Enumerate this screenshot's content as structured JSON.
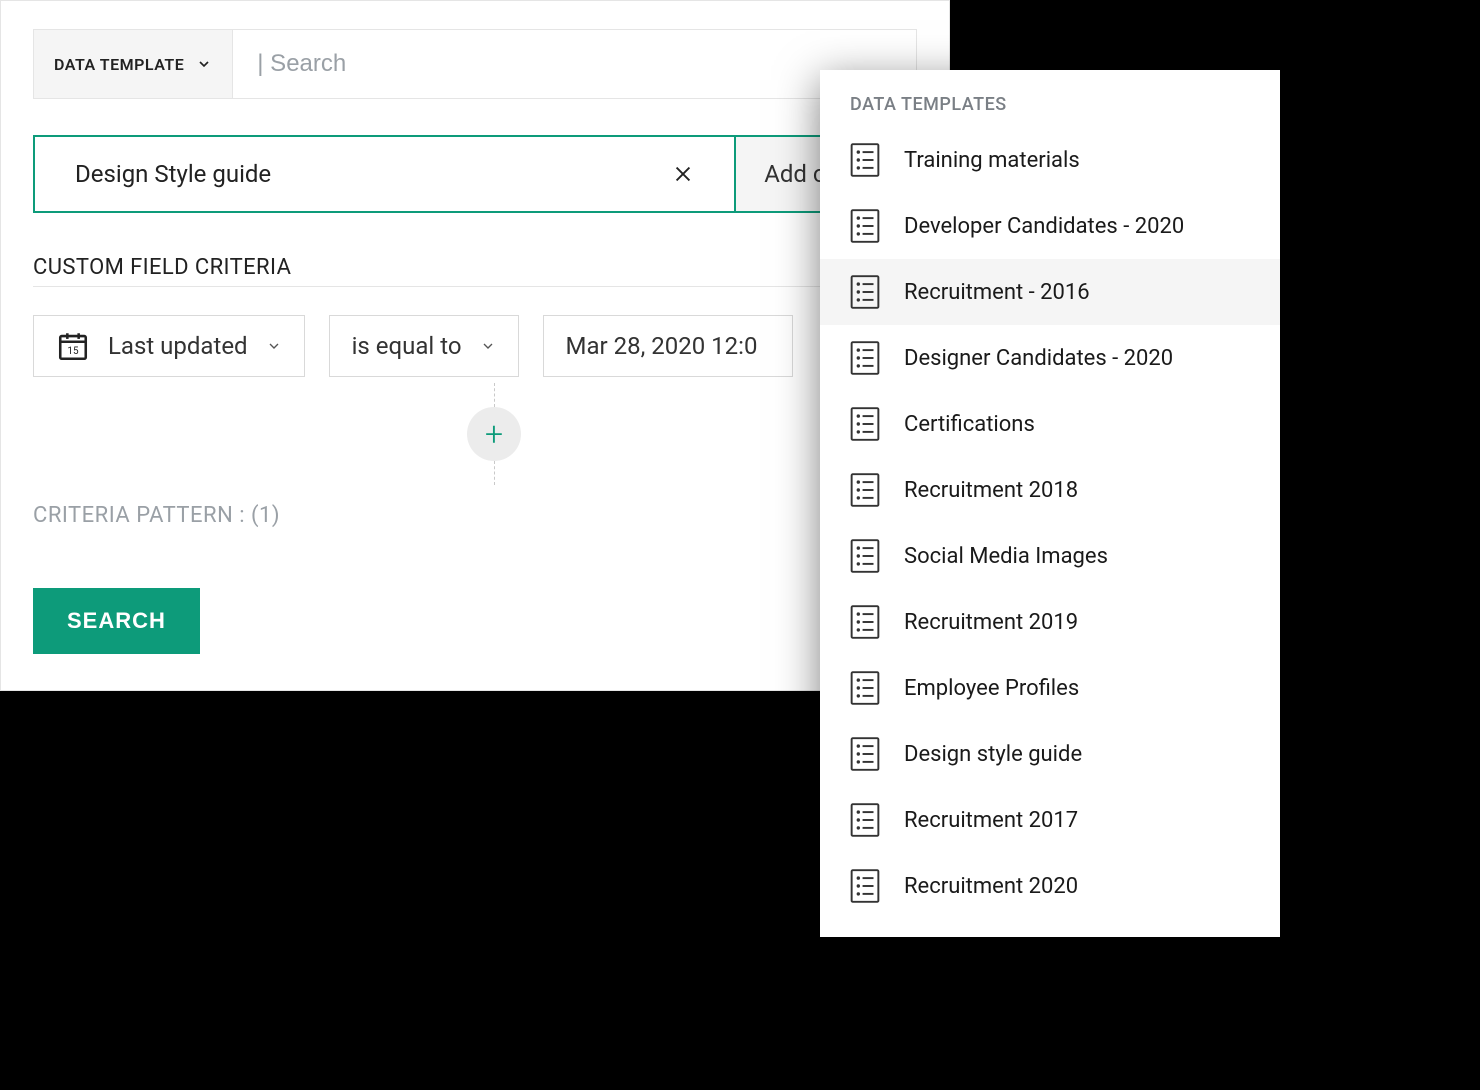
{
  "searchBar": {
    "typeLabel": "DATA TEMPLATE",
    "placeholder": "| Search"
  },
  "selectedPill": {
    "value": "Design Style guide",
    "addCriteriaLabel": "Add criteria"
  },
  "sectionTitle": "CUSTOM FIELD CRITERIA",
  "criteria": {
    "field": "Last updated",
    "operator": "is equal to",
    "value": "Mar 28, 2020 12:0"
  },
  "patternLabel": "CRITERIA PATTERN :",
  "patternValue": "(1)",
  "searchButton": "SEARCH",
  "dropdown": {
    "header": "DATA TEMPLATES",
    "items": [
      {
        "label": "Training materials",
        "hovered": false
      },
      {
        "label": "Developer Candidates - 2020",
        "hovered": false
      },
      {
        "label": "Recruitment - 2016",
        "hovered": true
      },
      {
        "label": "Designer Candidates - 2020",
        "hovered": false
      },
      {
        "label": "Certifications",
        "hovered": false
      },
      {
        "label": "Recruitment 2018",
        "hovered": false
      },
      {
        "label": "Social Media Images",
        "hovered": false
      },
      {
        "label": "Recruitment 2019",
        "hovered": false
      },
      {
        "label": "Employee Profiles",
        "hovered": false
      },
      {
        "label": "Design style guide",
        "hovered": false
      },
      {
        "label": "Recruitment 2017",
        "hovered": false
      },
      {
        "label": "Recruitment 2020",
        "hovered": false
      }
    ]
  },
  "colors": {
    "accent": "#0d9b7a",
    "mutedText": "#9aa0a6",
    "hoverBg": "#f5f5f5"
  }
}
